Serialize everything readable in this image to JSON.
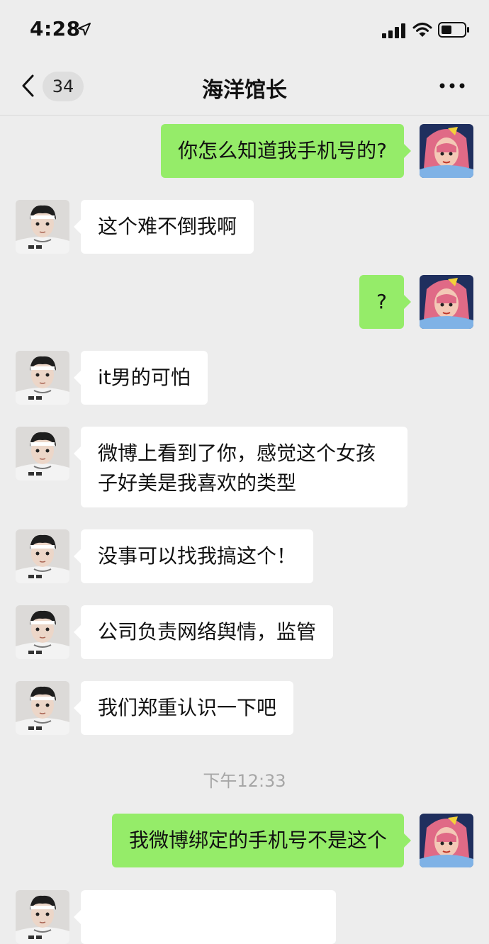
{
  "status_bar": {
    "time": "4:28",
    "icons": [
      "location-arrow-icon",
      "cellular-signal-icon",
      "wifi-icon",
      "battery-icon"
    ]
  },
  "nav": {
    "unread_count": "34",
    "title": "海洋馆长",
    "icons": [
      "back-chevron-icon",
      "more-icon"
    ]
  },
  "messages": [
    {
      "side": "out",
      "text": "你怎么知道我手机号的?"
    },
    {
      "side": "in",
      "text": "这个难不倒我啊"
    },
    {
      "side": "out",
      "text": "?"
    },
    {
      "side": "in",
      "text": "it男的可怕"
    },
    {
      "side": "in",
      "text": "微博上看到了你，感觉这个女孩子好美是我喜欢的类型"
    },
    {
      "side": "in",
      "text": "没事可以找我搞这个！"
    },
    {
      "side": "in",
      "text": "公司负责网络舆情，监管"
    },
    {
      "side": "in",
      "text": "我们郑重认识一下吧"
    },
    {
      "side": "out",
      "text": "我微博绑定的手机号不是这个"
    }
  ],
  "timestamp": "下午12:33",
  "colors": {
    "background": "#ededed",
    "outgoing_bubble": "#95ec69",
    "incoming_bubble": "#ffffff"
  }
}
